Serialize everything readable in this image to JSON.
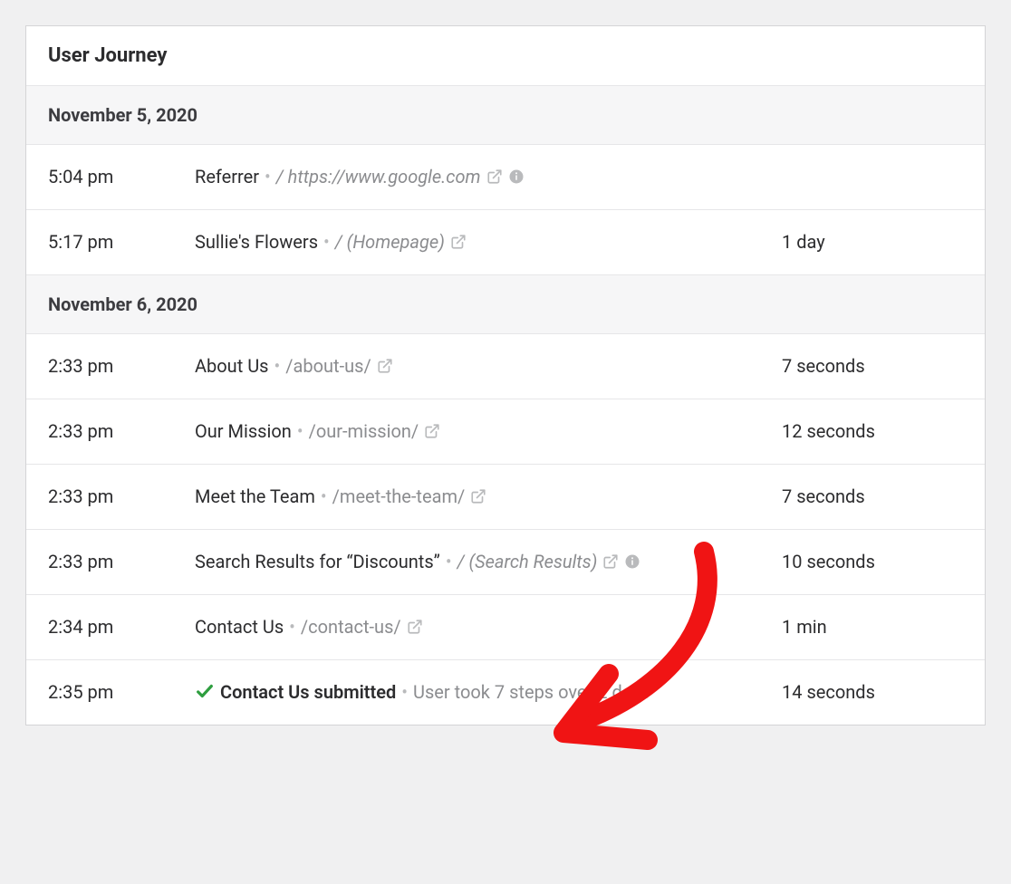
{
  "card": {
    "title": "User Journey"
  },
  "groups": [
    {
      "date": "November 5, 2020",
      "rows": [
        {
          "time": "5:04 pm",
          "title": "Referrer",
          "path": "/ https://www.google.com",
          "path_italic": true,
          "ext_link": true,
          "info": true,
          "duration": ""
        },
        {
          "time": "5:17 pm",
          "title": "Sullie's Flowers",
          "path": "/ (Homepage)",
          "path_italic": true,
          "ext_link": true,
          "info": false,
          "duration": "1 day"
        }
      ]
    },
    {
      "date": "November 6, 2020",
      "rows": [
        {
          "time": "2:33 pm",
          "title": "About Us",
          "path": "/about-us/",
          "path_italic": false,
          "ext_link": true,
          "info": false,
          "duration": "7 seconds"
        },
        {
          "time": "2:33 pm",
          "title": "Our Mission",
          "path": "/our-mission/",
          "path_italic": false,
          "ext_link": true,
          "info": false,
          "duration": "12 seconds"
        },
        {
          "time": "2:33 pm",
          "title": "Meet the Team",
          "path": "/meet-the-team/",
          "path_italic": false,
          "ext_link": true,
          "info": false,
          "duration": "7 seconds"
        },
        {
          "time": "2:33 pm",
          "title": "Search Results for “Discounts”",
          "path": "/ (Search Results)",
          "path_italic": true,
          "ext_link": true,
          "info": true,
          "duration": "10 seconds"
        },
        {
          "time": "2:34 pm",
          "title": "Contact Us",
          "path": "/contact-us/",
          "path_italic": false,
          "ext_link": true,
          "info": false,
          "duration": "1 min"
        },
        {
          "time": "2:35 pm",
          "check": true,
          "title": "Contact Us submitted",
          "title_bold": true,
          "summary": "User took 7 steps over 2 days",
          "duration": "14 seconds"
        }
      ]
    }
  ],
  "icon_color": "#b9babc",
  "check_color": "#2e9e3f",
  "annotation": {
    "arrow_color": "#f01414",
    "points_to": "contact-us-row"
  }
}
